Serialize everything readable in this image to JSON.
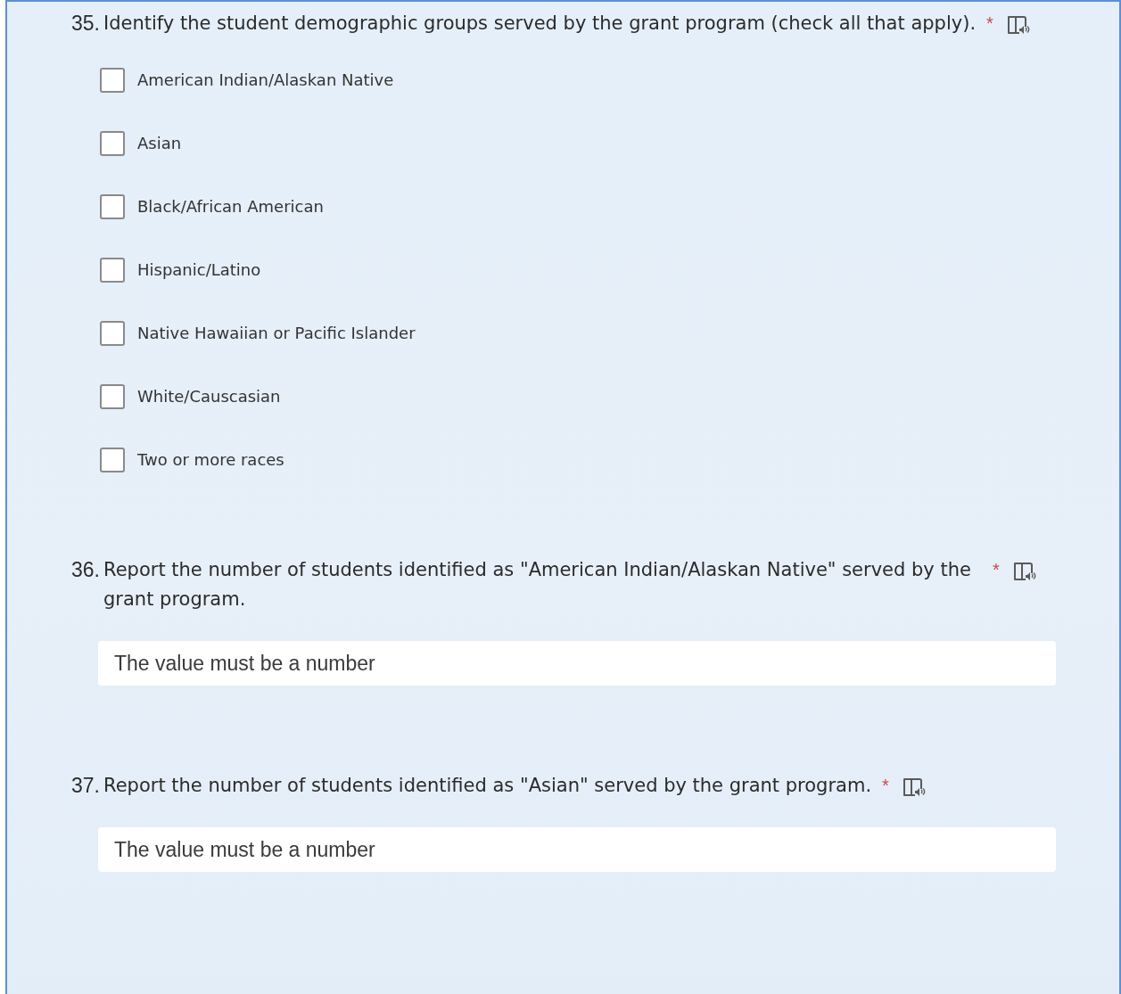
{
  "questions": [
    {
      "number": "35.",
      "kind": "choice",
      "title": "Identify the student demographic groups served by the grant program (check all that apply).",
      "required_mark": "*",
      "options": [
        {
          "label": "American Indian/Alaskan Native",
          "checked": false
        },
        {
          "label": "Asian",
          "checked": false
        },
        {
          "label": "Black/African American",
          "checked": false
        },
        {
          "label": "Hispanic/Latino",
          "checked": false
        },
        {
          "label": "Native Hawaiian or Pacific Islander",
          "checked": false
        },
        {
          "label": "White/Causcasian",
          "checked": false
        },
        {
          "label": "Two or more races",
          "checked": false
        }
      ]
    },
    {
      "number": "36.",
      "kind": "number",
      "title": "Report the number of students identified as \"American Indian/Alaskan Native\" served by the grant program.",
      "required_mark": "*",
      "placeholder": "The value must be a number"
    },
    {
      "number": "37.",
      "kind": "number",
      "title": "Report the number of students identified as \"Asian\" served by the grant program.",
      "required_mark": "*",
      "placeholder": "The value must be a number"
    }
  ]
}
